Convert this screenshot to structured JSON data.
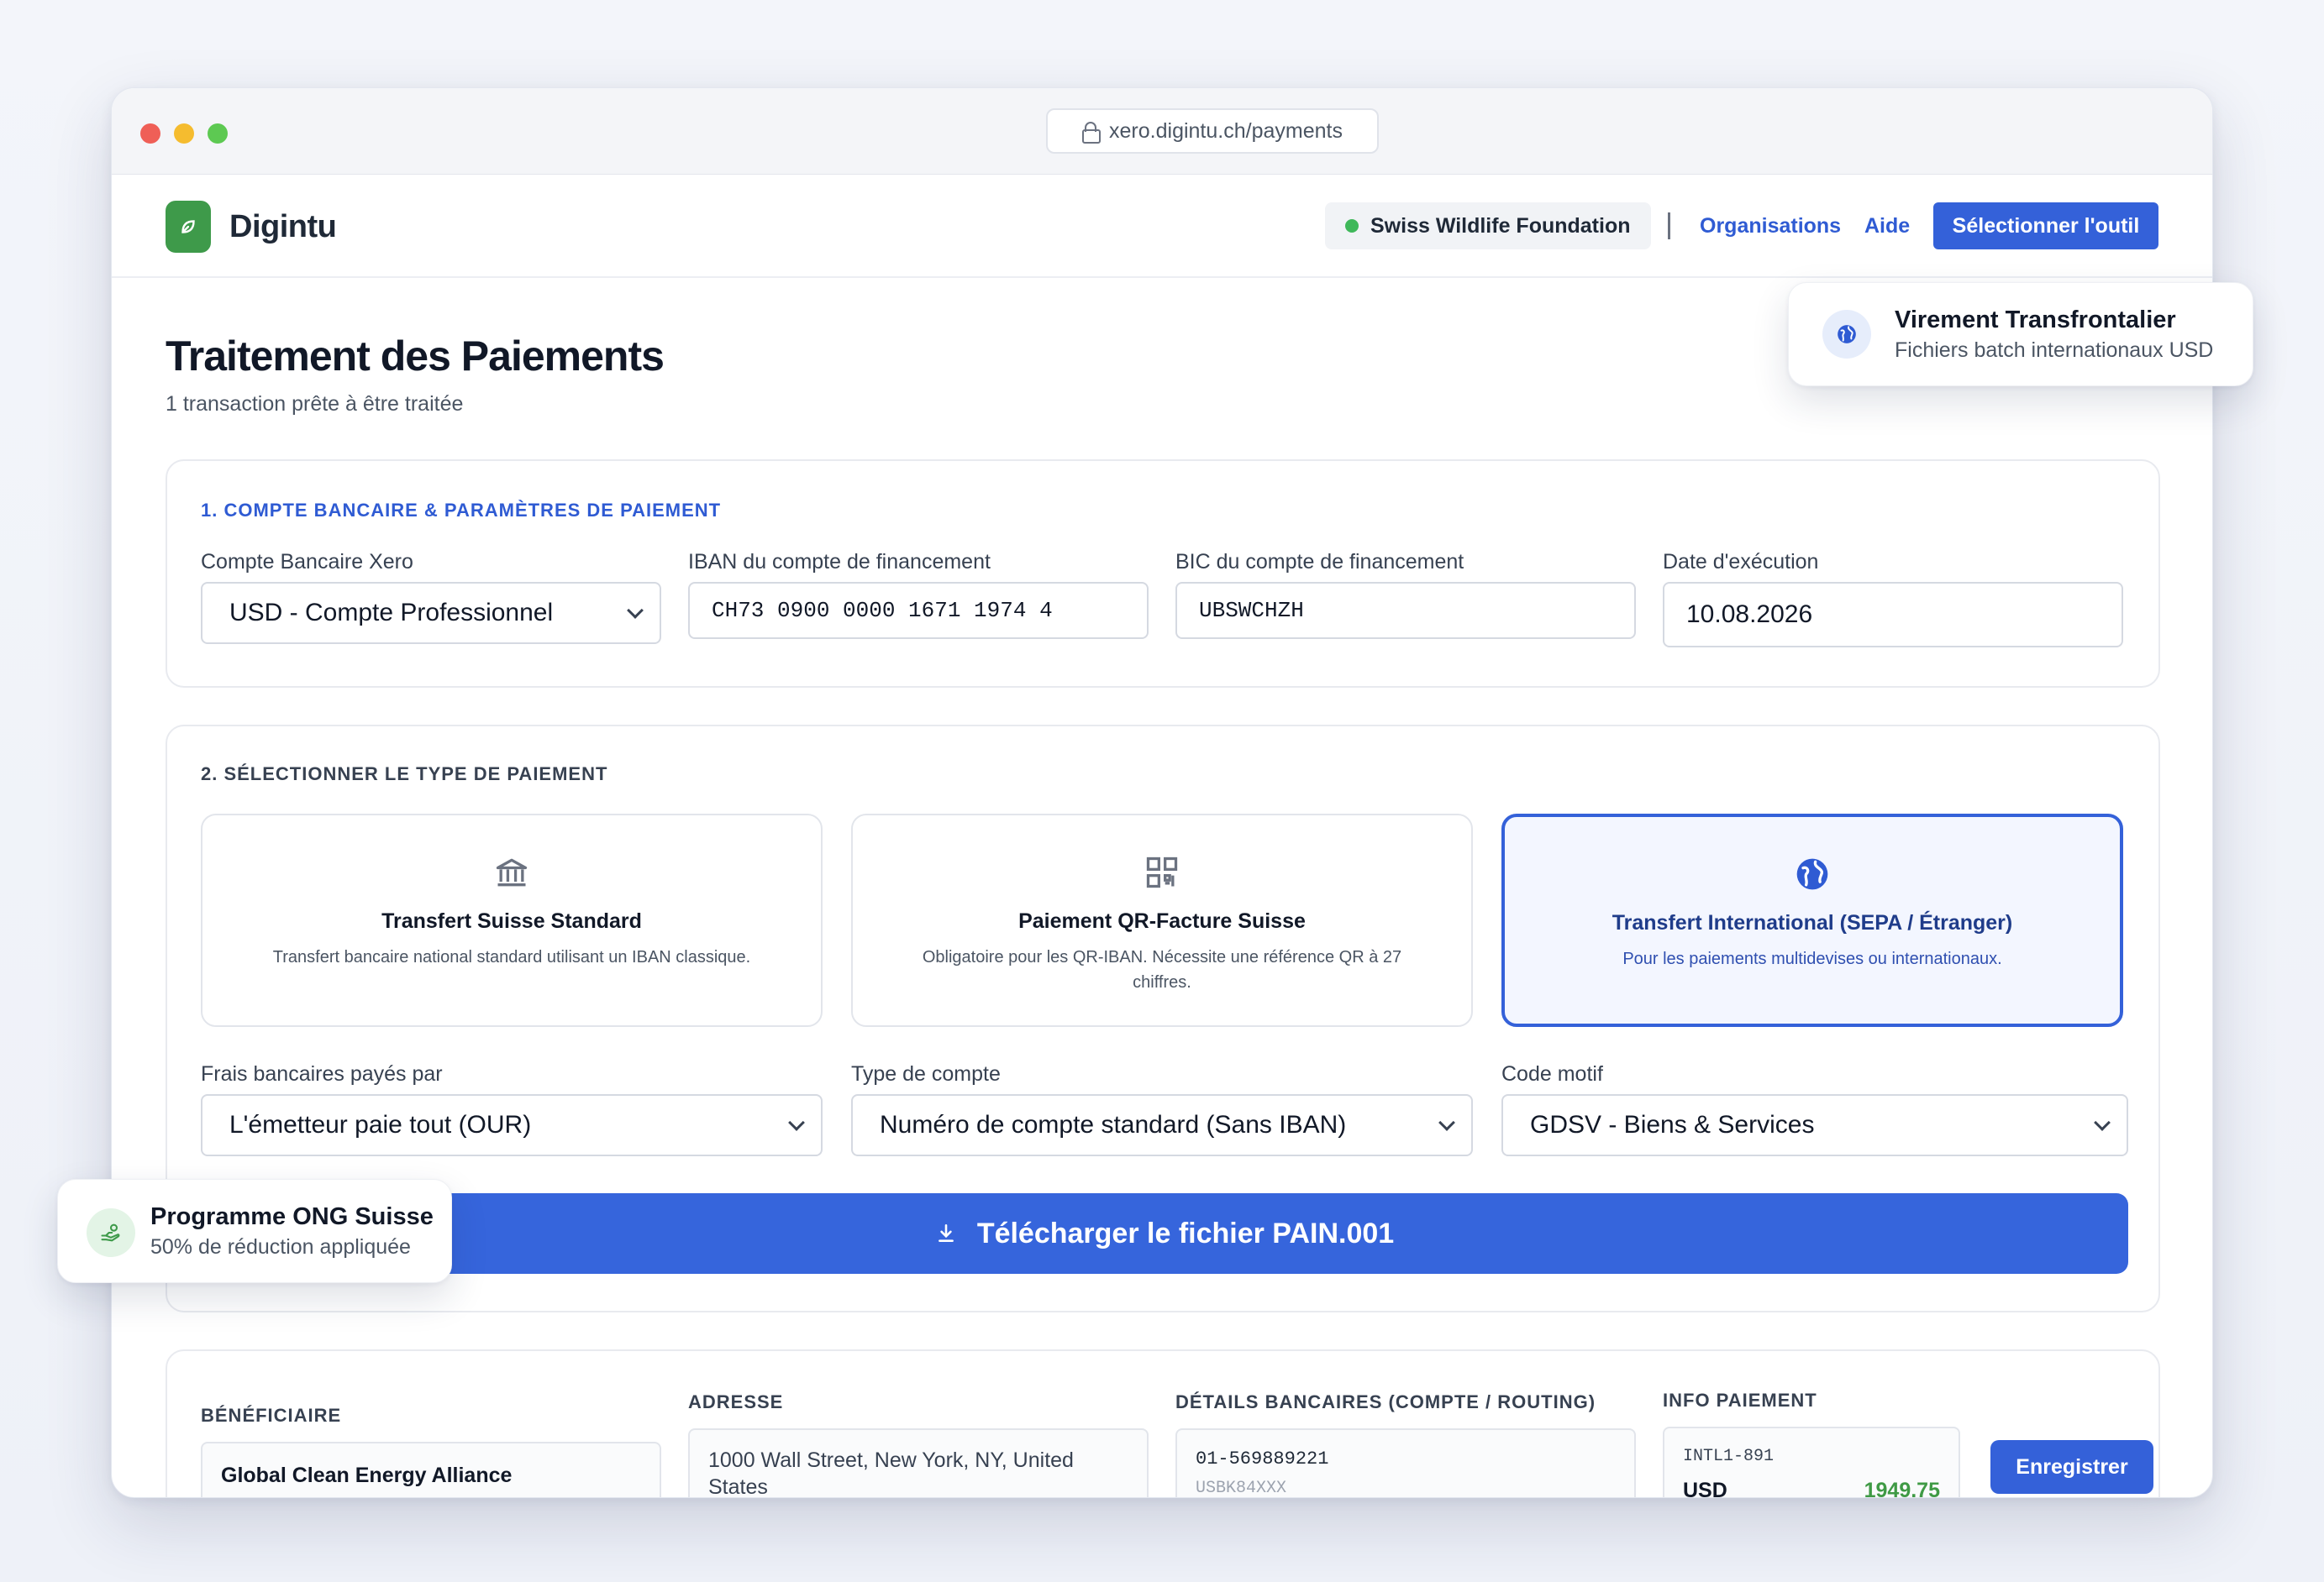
{
  "browser": {
    "url": "xero.digintu.ch/payments"
  },
  "header": {
    "brand": "Digintu",
    "organization": "Swiss Wildlife Foundation",
    "nav": {
      "organisations": "Organisations",
      "aide": "Aide"
    },
    "select_tool_label": "Sélectionner l'outil"
  },
  "page": {
    "title": "Traitement des Paiements",
    "subtitle": "1 transaction prête à être traitée"
  },
  "section1": {
    "title": "1. COMPTE BANCAIRE & PARAMÈTRES DE PAIEMENT",
    "bank_account": {
      "label": "Compte Bancaire Xero",
      "value": "USD - Compte Professionnel"
    },
    "iban": {
      "label": "IBAN du compte de financement",
      "value": "CH73 0900 0000 1671 1974 4"
    },
    "bic": {
      "label": "BIC du compte de financement",
      "value": "UBSWCHZH"
    },
    "date": {
      "label": "Date d'exécution",
      "value": "10.08.2026"
    }
  },
  "section2": {
    "title": "2. SÉLECTIONNER LE TYPE DE PAIEMENT",
    "types": [
      {
        "title": "Transfert Suisse Standard",
        "desc": "Transfert bancaire national standard utilisant un IBAN classique.",
        "icon": "bank-icon",
        "selected": false
      },
      {
        "title": "Paiement QR-Facture Suisse",
        "desc": "Obligatoire pour les QR-IBAN. Nécessite une référence QR à 27 chiffres.",
        "icon": "qr-code-icon",
        "selected": false
      },
      {
        "title": "Transfert International (SEPA / Étranger)",
        "desc": "Pour les paiements multidevises ou internationaux.",
        "icon": "globe-icon",
        "selected": true
      }
    ],
    "fees": {
      "label": "Frais bancaires payés par",
      "value": "L'émetteur paie tout (OUR)"
    },
    "account_type": {
      "label": "Type de compte",
      "value": "Numéro de compte standard (Sans IBAN)"
    },
    "reason_code": {
      "label": "Code motif",
      "value": "GDSV - Biens & Services"
    },
    "download_label": "Télécharger le fichier PAIN.001"
  },
  "transactions": {
    "headers": {
      "beneficiary": "BÉNÉFICIAIRE",
      "address": "ADRESSE",
      "bank_details": "DÉTAILS BANCAIRES (COMPTE / ROUTING)",
      "payment_info": "INFO PAIEMENT"
    },
    "rows": [
      {
        "beneficiary": "Global Clean Energy Alliance",
        "address": "1000 Wall Street, New York, NY, United States",
        "account": "01-569889221",
        "routing": "USBK84XXX",
        "reference": "INTL1-891",
        "currency": "USD",
        "amount": "1949,75",
        "save_label": "Enregistrer"
      }
    ]
  },
  "floating": {
    "crossborder": {
      "title": "Virement Transfrontalier",
      "subtitle": "Fichiers batch internationaux USD"
    },
    "ngo": {
      "title": "Programme ONG Suisse",
      "subtitle": "50% de réduction appliquée"
    }
  },
  "colors": {
    "accent": "#3461d9",
    "brand_green": "#3e9a4a",
    "amount_green": "#3f9a45"
  }
}
